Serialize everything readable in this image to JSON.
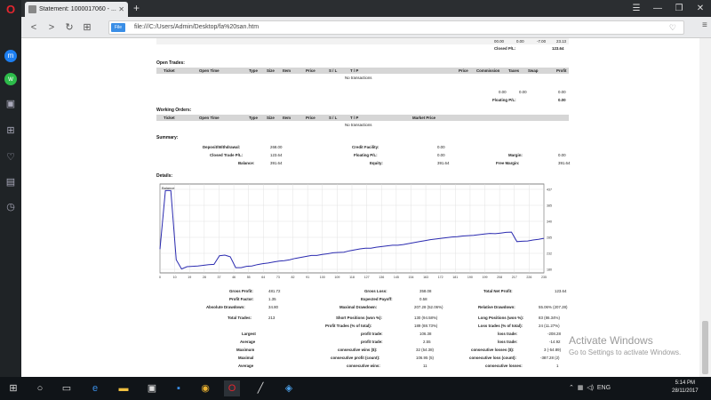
{
  "browser": {
    "tab_title": "Statement: 1000017060 - ...",
    "url": "file:///C:/Users/Admin/Desktop/fa%20san.htm",
    "file_badge": "File"
  },
  "sections": {
    "open_trades": "Open Trades:",
    "working_orders": "Working Orders:",
    "summary": "Summary:",
    "details": "Details:"
  },
  "top_rows": {
    "row1": [
      "00.00",
      "0.00",
      "-7.00",
      "23.13"
    ],
    "closed_pl_label": "Closed P/L:",
    "closed_pl_value": "123.64"
  },
  "trade_headers": [
    "Ticket",
    "Open Time",
    "Type",
    "Size",
    "Item",
    "Price",
    "S / L",
    "T / P",
    "",
    "Price",
    "Commission",
    "Taxes",
    "Swap",
    "Profit"
  ],
  "order_headers": [
    "Ticket",
    "Open Time",
    "Type",
    "Size",
    "Item",
    "Price",
    "S / L",
    "T / P",
    "Market Price"
  ],
  "no_transactions": "No transactions",
  "open_totals": [
    "0.00",
    "0.00",
    "0.00"
  ],
  "floating_pl_label": "Floating P/L:",
  "floating_pl_value": "0.00",
  "summary": {
    "deposit_label": "Deposit/Withdrawal:",
    "deposit_value": "268.00",
    "credit_label": "Credit Facility:",
    "credit_value": "0.00",
    "closed_label": "Closed Trade P/L:",
    "closed_value": "123.64",
    "floating_label": "Floating P/L:",
    "floating_value": "0.00",
    "margin_label": "Margin:",
    "margin_value": "0.00",
    "balance_label": "Balance:",
    "balance_value": "391.64",
    "equity_label": "Equity:",
    "equity_value": "391.64",
    "freemargin_label": "Free Margin:",
    "freemargin_value": "391.64"
  },
  "chart_data": {
    "type": "line",
    "title": "Balance",
    "x": [
      0,
      1,
      2,
      3,
      4,
      5,
      6,
      7,
      8,
      9,
      10,
      11,
      12,
      13,
      14,
      15,
      16,
      17,
      18,
      19,
      20,
      21,
      22,
      23,
      24,
      25,
      26,
      27,
      28,
      29,
      30,
      31,
      32,
      33,
      34,
      35,
      36,
      37,
      38,
      39,
      40,
      41,
      42,
      43,
      44,
      45,
      46,
      47,
      48,
      49,
      50,
      51,
      52,
      53,
      54,
      55,
      56,
      57,
      58,
      59,
      60,
      61,
      62,
      63,
      64,
      65,
      66,
      67,
      68,
      69,
      70,
      71
    ],
    "series": [
      {
        "values": [
          252,
          430,
          430,
          220,
          192,
          199,
          200,
          201,
          203,
          205,
          206,
          232,
          234,
          229,
          196,
          196,
          200,
          201,
          205,
          208,
          210,
          213,
          216,
          217,
          220,
          224,
          227,
          230,
          233,
          233,
          236,
          238,
          241,
          242,
          243,
          247,
          250,
          253,
          255,
          255,
          258,
          260,
          262,
          264,
          264,
          266,
          269,
          272,
          275,
          278,
          281,
          283,
          285,
          287,
          289,
          290,
          292,
          293,
          294,
          296,
          298,
          300,
          299,
          301,
          303,
          304,
          275,
          276,
          277,
          280,
          282,
          285
        ]
      }
    ],
    "xticks": [
      "0",
      "10",
      "19",
      "28",
      "37",
      "46",
      "55",
      "64",
      "73",
      "82",
      "91",
      "100",
      "109",
      "118",
      "127",
      "136",
      "145",
      "154",
      "163",
      "172",
      "181",
      "190",
      "199",
      "208",
      "217",
      "226",
      "235"
    ],
    "yticks": [
      "437",
      "385",
      "340",
      "285",
      "232",
      "180"
    ],
    "ylim": [
      180,
      450
    ],
    "grid": true
  },
  "stats": {
    "r1": [
      "Gross Profit:",
      "481.72",
      "Gross Loss:",
      "358.08",
      "Total Net Profit:",
      "123.64"
    ],
    "r2": [
      "Profit Factor:",
      "1.35",
      "Expected Payoff:",
      "0.58"
    ],
    "r3": [
      "Absolute Drawdown:",
      "34.80",
      "Maximal Drawdown:",
      "207.28 (52.06%)",
      "Relative Drawdown:",
      "55.06% (207.28)"
    ],
    "r4": [
      "Total Trades:",
      "213",
      "Short Positions (won %):",
      "130 (94.58%)",
      "Long Positions (won %):",
      "83 (86.34%)"
    ],
    "r5": [
      "Profit Trades (% of total):",
      "189 (88.73%)",
      "Loss trades (% of total):",
      "24 (11.27%)"
    ],
    "r6": [
      "Largest",
      "profit trade:",
      "106.38",
      "loss trade:",
      "-208.28"
    ],
    "r7": [
      "Average",
      "profit trade:",
      "2.55",
      "loss trade:",
      "-14.92"
    ],
    "r8": [
      "Maximum",
      "consecutive wins ($):",
      "32 (54.38)",
      "consecutive losses ($):",
      "3 (-54.89)"
    ],
    "r9": [
      "Maximal",
      "consecutive profit (count):",
      "106.95 (5)",
      "consecutive loss (count):",
      "-387.28 (2)"
    ],
    "r10": [
      "Average",
      "consecutive wins:",
      "11",
      "consecutive losses:",
      "1"
    ]
  },
  "watermark": {
    "title": "Activate Windows",
    "sub": "Go to Settings to activate Windows."
  },
  "taskbar": {
    "time": "5:14 PM",
    "date": "28/11/2017",
    "lang": "ENG"
  }
}
